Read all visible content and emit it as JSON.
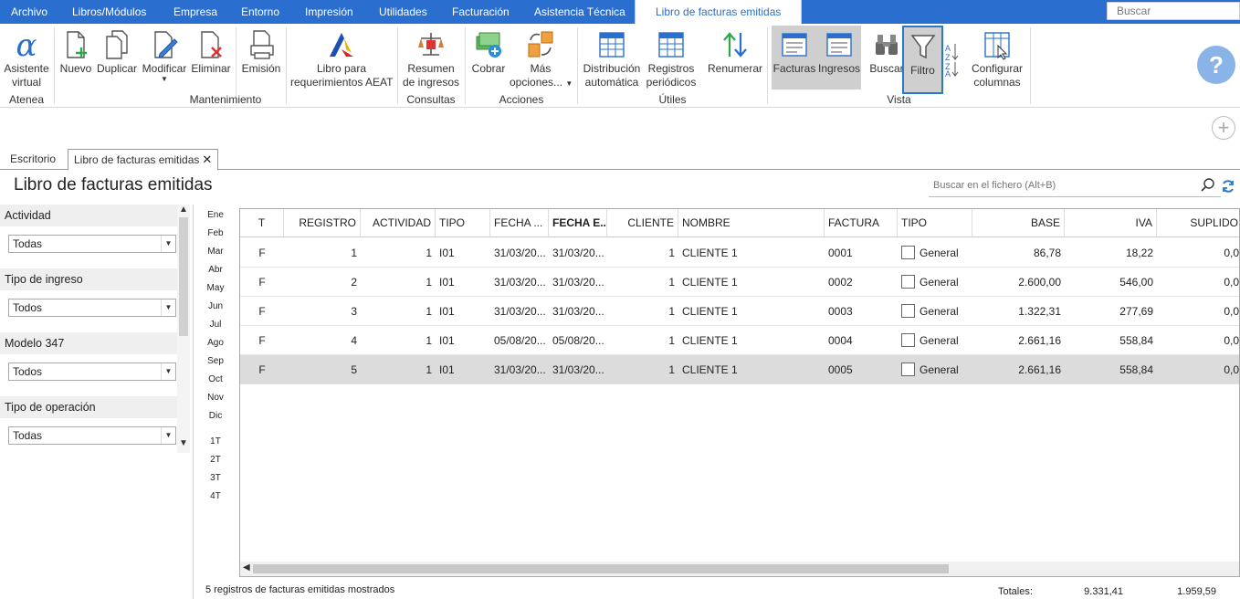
{
  "menubar": {
    "items": [
      "Archivo",
      "Libros/Módulos",
      "Empresa",
      "Entorno",
      "Impresión",
      "Utilidades",
      "Facturación",
      "Asistencia Técnica",
      "Libro de facturas emitidas"
    ],
    "search_placeholder": "Buscar"
  },
  "ribbon": {
    "asistente": [
      "Asistente",
      "virtual"
    ],
    "nuevo": "Nuevo",
    "duplicar": "Duplicar",
    "modificar": "Modificar",
    "eliminar": "Eliminar",
    "emision": "Emisión",
    "libro_aeat": [
      "Libro para",
      "requerimientos AEAT"
    ],
    "resumen": [
      "Resumen",
      "de ingresos"
    ],
    "cobrar": "Cobrar",
    "mas": [
      "Más",
      "opciones..."
    ],
    "distribucion": [
      "Distribución",
      "automática"
    ],
    "registros": [
      "Registros",
      "periódicos"
    ],
    "renumerar": "Renumerar",
    "facturas": "Facturas",
    "ingresos": "Ingresos",
    "buscar": "Buscar",
    "filtro": "Filtro",
    "configurar": [
      "Configurar",
      "columnas"
    ],
    "groups": {
      "atenea": "Atenea",
      "mantenimiento": "Mantenimiento",
      "consultas": "Consultas",
      "acciones": "Acciones",
      "utiles": "Útiles",
      "vista": "Vista"
    },
    "help_icon": "?"
  },
  "tabs": {
    "escritorio": "Escritorio",
    "libro": "Libro de facturas emitidas"
  },
  "page": {
    "title": "Libro de facturas emitidas",
    "search_placeholder": "Buscar en el fichero (Alt+B)"
  },
  "filters": [
    {
      "label": "Actividad",
      "value": "Todas"
    },
    {
      "label": "Tipo de ingreso",
      "value": "Todos"
    },
    {
      "label": "Modelo 347",
      "value": "Todos"
    },
    {
      "label": "Tipo de operación",
      "value": "Todas"
    }
  ],
  "months": [
    "Ene",
    "Feb",
    "Mar",
    "Abr",
    "May",
    "Jun",
    "Jul",
    "Ago",
    "Sep",
    "Oct",
    "Nov",
    "Dic"
  ],
  "quarters": [
    "1T",
    "2T",
    "3T",
    "4T"
  ],
  "grid": {
    "columns": [
      "T",
      "REGISTRO",
      "ACTIVIDAD",
      "TIPO",
      "FECHA ...",
      "FECHA E...",
      "CLIENTE",
      "NOMBRE",
      "FACTURA",
      "TIPO",
      "BASE",
      "IVA",
      "SUPLIDO"
    ],
    "rows": [
      [
        "F",
        "1",
        "1",
        "I01",
        "31/03/20...",
        "31/03/20...",
        "1",
        "CLIENTE 1",
        "0001",
        "General",
        "86,78",
        "18,22",
        "0,0"
      ],
      [
        "F",
        "2",
        "1",
        "I01",
        "31/03/20...",
        "31/03/20...",
        "1",
        "CLIENTE 1",
        "0002",
        "General",
        "2.600,00",
        "546,00",
        "0,0"
      ],
      [
        "F",
        "3",
        "1",
        "I01",
        "31/03/20...",
        "31/03/20...",
        "1",
        "CLIENTE 1",
        "0003",
        "General",
        "1.322,31",
        "277,69",
        "0,0"
      ],
      [
        "F",
        "4",
        "1",
        "I01",
        "05/08/20...",
        "05/08/20...",
        "1",
        "CLIENTE 1",
        "0004",
        "General",
        "2.661,16",
        "558,84",
        "0,0"
      ],
      [
        "F",
        "5",
        "1",
        "I01",
        "31/03/20...",
        "31/03/20...",
        "1",
        "CLIENTE 1",
        "0005",
        "General",
        "2.661,16",
        "558,84",
        "0,0"
      ]
    ],
    "selected_row": 5
  },
  "status": {
    "text": "5 registros de facturas emitidas mostrados",
    "totals_label": "Totales:",
    "total_base": "9.331,41",
    "total_iva": "1.959,59"
  },
  "colors": {
    "menubar": "#2a6fd0",
    "accent": "#2a78c8",
    "selected": "#dcdcdc"
  }
}
